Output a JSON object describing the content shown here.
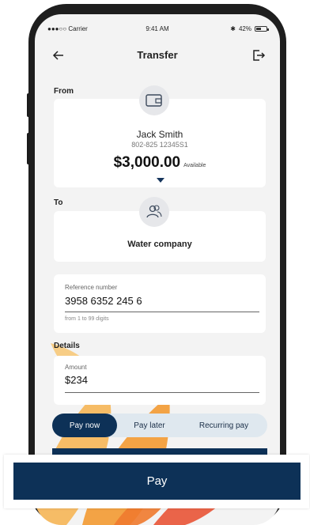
{
  "status_bar": {
    "carrier": "●●●○○ Carrier",
    "time": "9:41 AM",
    "battery": "42%"
  },
  "header": {
    "title": "Transfer",
    "back_icon": "arrow-left-icon",
    "logout_icon": "logout-icon"
  },
  "from": {
    "label": "From",
    "icon": "wallet-icon",
    "name": "Jack Smith",
    "account": "802-825 12345S1",
    "balance": "$3,000.00",
    "balance_suffix": "Available"
  },
  "to": {
    "label": "To",
    "icon": "people-icon",
    "payee": "Water company"
  },
  "reference": {
    "label": "Reference number",
    "value": "3958 6352 245 6",
    "hint": "from 1 to 99 digits"
  },
  "details": {
    "label": "Details",
    "amount_label": "Amount",
    "amount_value": "$234"
  },
  "schedule_tabs": [
    {
      "label": "Pay now",
      "active": true
    },
    {
      "label": "Pay later",
      "active": false
    },
    {
      "label": "Recurring pay",
      "active": false
    }
  ],
  "pay_button": "Pay",
  "colors": {
    "primary": "#0d3157",
    "segment_bg": "#dfe8ef",
    "accent_orange": "#f0a23c"
  }
}
